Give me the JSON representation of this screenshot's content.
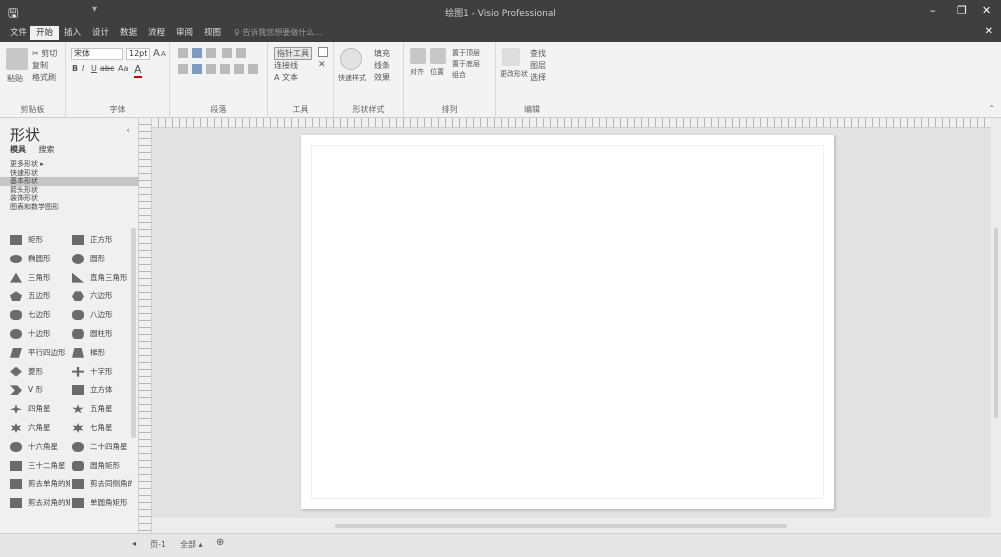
{
  "titlebar": {
    "save_icon": "save-icon",
    "qat_extra": "▾",
    "title": "绘图1 - Visio Professional",
    "minimize": "–",
    "restore": "❐",
    "close": "✕"
  },
  "menu": {
    "tabs": [
      "文件",
      "开始",
      "插入",
      "设计",
      "数据",
      "流程",
      "审阅",
      "视图"
    ],
    "tell_me": "♀ 告诉我您想要做什么…",
    "close_doc": "✕"
  },
  "ribbon": {
    "clipboard": {
      "paste": "粘贴",
      "cut": "✂ 剪切",
      "copy": "复制",
      "format_painter": "格式刷",
      "label": "剪贴板"
    },
    "font": {
      "family": "宋体",
      "size": "12pt",
      "grow": "A",
      "shrink": "A",
      "bold": "B",
      "italic": "I",
      "underline": "U",
      "strike": "abc",
      "case": "Aa",
      "color": "A",
      "label": "字体"
    },
    "paragraph": {
      "label": "段落"
    },
    "tools": {
      "pointer": "指针工具",
      "connector": "连接线",
      "text": "A 文本",
      "label": "工具"
    },
    "shape_styles": {
      "quick": "快速样式",
      "fill": "填充",
      "line": "线条",
      "effects": "效果",
      "label": "形状样式"
    },
    "arrange": {
      "align": "对齐",
      "position": "位置",
      "bring_forward": "置于顶层",
      "send_backward": "置于底层",
      "group": "组合",
      "label": "排列"
    },
    "editing": {
      "change_shape": "更改形状",
      "find": "查找",
      "layers": "图层",
      "select": "选择",
      "label": "编辑"
    },
    "collapse": "⌃"
  },
  "shapes_pane": {
    "title": "形状",
    "close": "‹",
    "tabs": [
      "模具",
      "搜索"
    ],
    "stencils": [
      "更多形状 ▸",
      "快速形状",
      "基本形状",
      "箭头形状",
      "装饰形状",
      "图表和数学图形"
    ],
    "selected_stencil": 2,
    "items": [
      {
        "label": "矩形",
        "glyph": "rect"
      },
      {
        "label": "正方形",
        "glyph": "square"
      },
      {
        "label": "椭圆形",
        "glyph": "ellipse"
      },
      {
        "label": "圆形",
        "glyph": "circle"
      },
      {
        "label": "三角形",
        "glyph": "triangle"
      },
      {
        "label": "直角三角形",
        "glyph": "right-triangle"
      },
      {
        "label": "五边形",
        "glyph": "pentagon"
      },
      {
        "label": "六边形",
        "glyph": "hexagon"
      },
      {
        "label": "七边形",
        "glyph": "heptagon"
      },
      {
        "label": "八边形",
        "glyph": "octagon"
      },
      {
        "label": "十边形",
        "glyph": "decagon"
      },
      {
        "label": "圆柱形",
        "glyph": "cylinder"
      },
      {
        "label": "平行四边形",
        "glyph": "parallelogram"
      },
      {
        "label": "梯形",
        "glyph": "trapezoid"
      },
      {
        "label": "菱形",
        "glyph": "diamond"
      },
      {
        "label": "十字形",
        "glyph": "cross"
      },
      {
        "label": "V 形",
        "glyph": "chevron"
      },
      {
        "label": "立方体",
        "glyph": "cube"
      },
      {
        "label": "四角星",
        "glyph": "star4"
      },
      {
        "label": "五角星",
        "glyph": "star5"
      },
      {
        "label": "六角星",
        "glyph": "star6"
      },
      {
        "label": "七角星",
        "glyph": "star7"
      },
      {
        "label": "十六角星",
        "glyph": "star16"
      },
      {
        "label": "二十四角星",
        "glyph": "star24"
      },
      {
        "label": "三十二角星",
        "glyph": "star32"
      },
      {
        "label": "圆角矩形",
        "glyph": "rounded-rect"
      },
      {
        "label": "剪去单角的矩形",
        "glyph": "snip-rect"
      },
      {
        "label": "剪去同侧角的矩形",
        "glyph": "snip-same"
      },
      {
        "label": "剪去对角的矩形",
        "glyph": "snip-diag"
      },
      {
        "label": "单圆角矩形",
        "glyph": "round-one"
      }
    ]
  },
  "status": {
    "prev": "◂",
    "page": "页-1",
    "all": "全部 ▴",
    "add": "⊕"
  }
}
